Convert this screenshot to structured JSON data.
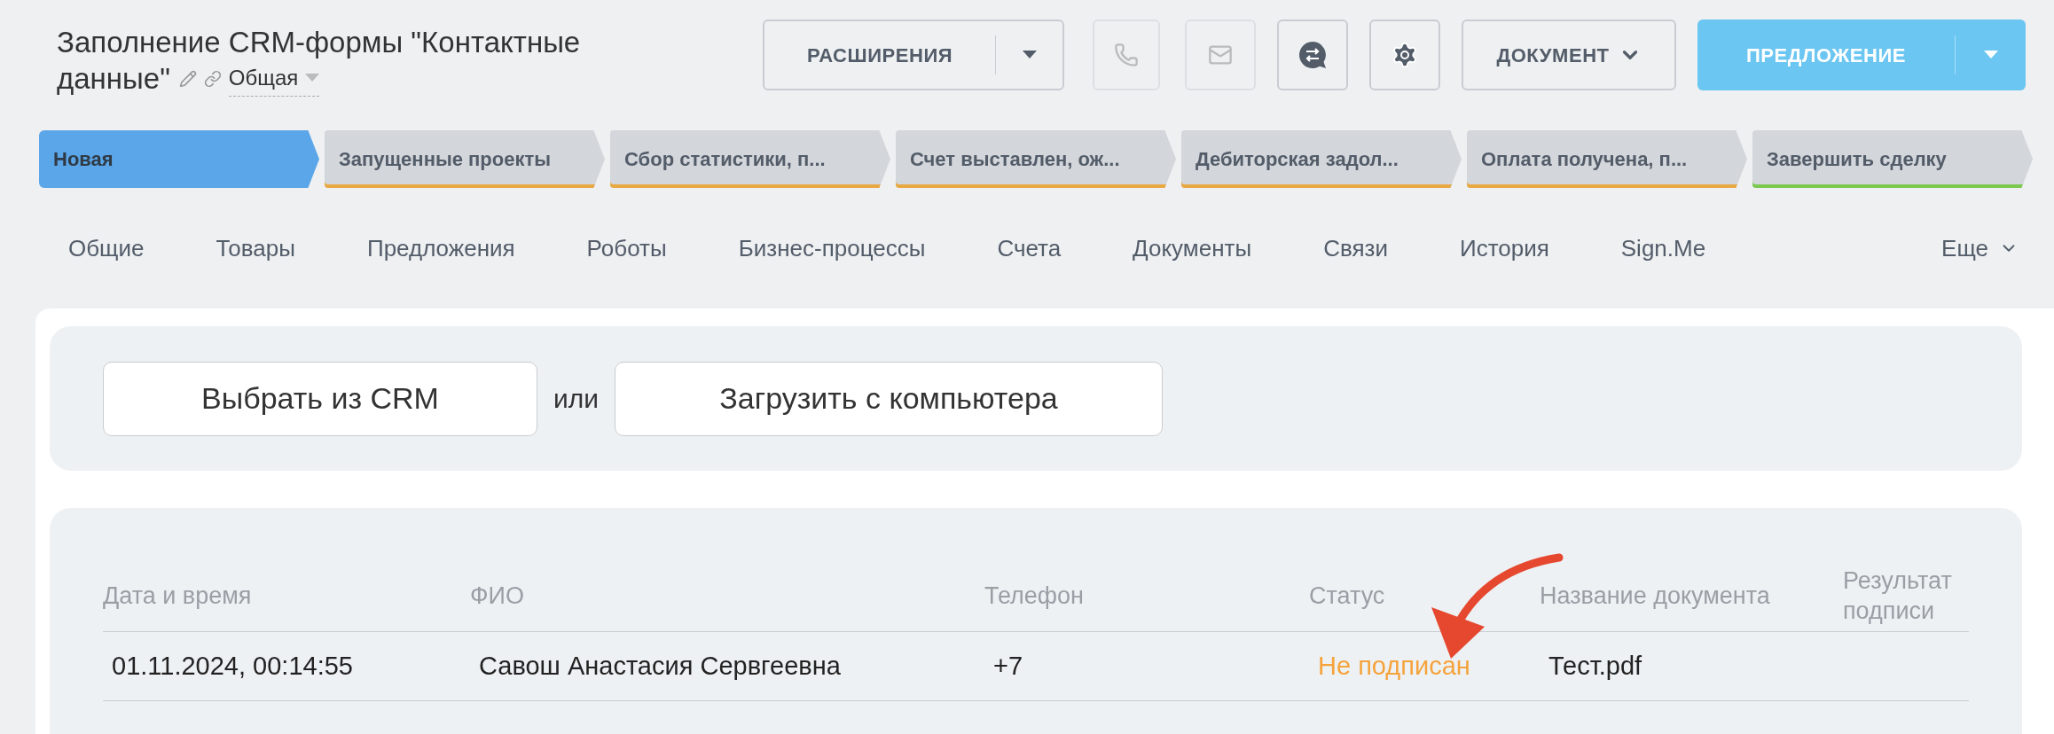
{
  "header": {
    "title_lines": [
      "Заполнение CRM-формы \"Контактные",
      "данные\""
    ],
    "category": "Общая"
  },
  "toolbar": {
    "extensions_button": "РАСШИРЕНИЯ",
    "phone_disabled": true,
    "mail_disabled": true,
    "document_button": "ДОКУМЕНТ",
    "offer_button": "ПРЕДЛОЖЕНИЕ"
  },
  "stages": [
    {
      "label": "Новая",
      "selected": true,
      "color": "#5aa6e8"
    },
    {
      "label": "Запущенные проекты",
      "selected": false,
      "color": "#e8a842"
    },
    {
      "label": "Сбор статистики, п...",
      "selected": false,
      "color": "#e8a842"
    },
    {
      "label": "Счет выставлен, ож...",
      "selected": false,
      "color": "#e8a842"
    },
    {
      "label": "Дебиторская задол...",
      "selected": false,
      "color": "#e8a842"
    },
    {
      "label": "Оплата получена, п...",
      "selected": false,
      "color": "#e8a842"
    },
    {
      "label": "Завершить сделку",
      "selected": false,
      "color": "#7cc950"
    }
  ],
  "tabs": [
    "Общие",
    "Товары",
    "Предложения",
    "Роботы",
    "Бизнес-процессы",
    "Счета",
    "Документы",
    "Связи",
    "История",
    "Sign.Me"
  ],
  "more_tab": "Еще",
  "upload": {
    "crm_button": "Выбрать из CRM",
    "separator": "или",
    "computer_button": "Загрузить с компьютера"
  },
  "table": {
    "columns": [
      "Дата и время",
      "ФИО",
      "Телефон",
      "Статус",
      "Название документа",
      "Результат подписи"
    ],
    "rows": [
      {
        "date": "01.11.2024, 00:14:55",
        "name": "Савош Анастасия Сервгеевна",
        "phone": "+7",
        "status": "Не подписан",
        "document": "Тест.pdf"
      }
    ]
  }
}
